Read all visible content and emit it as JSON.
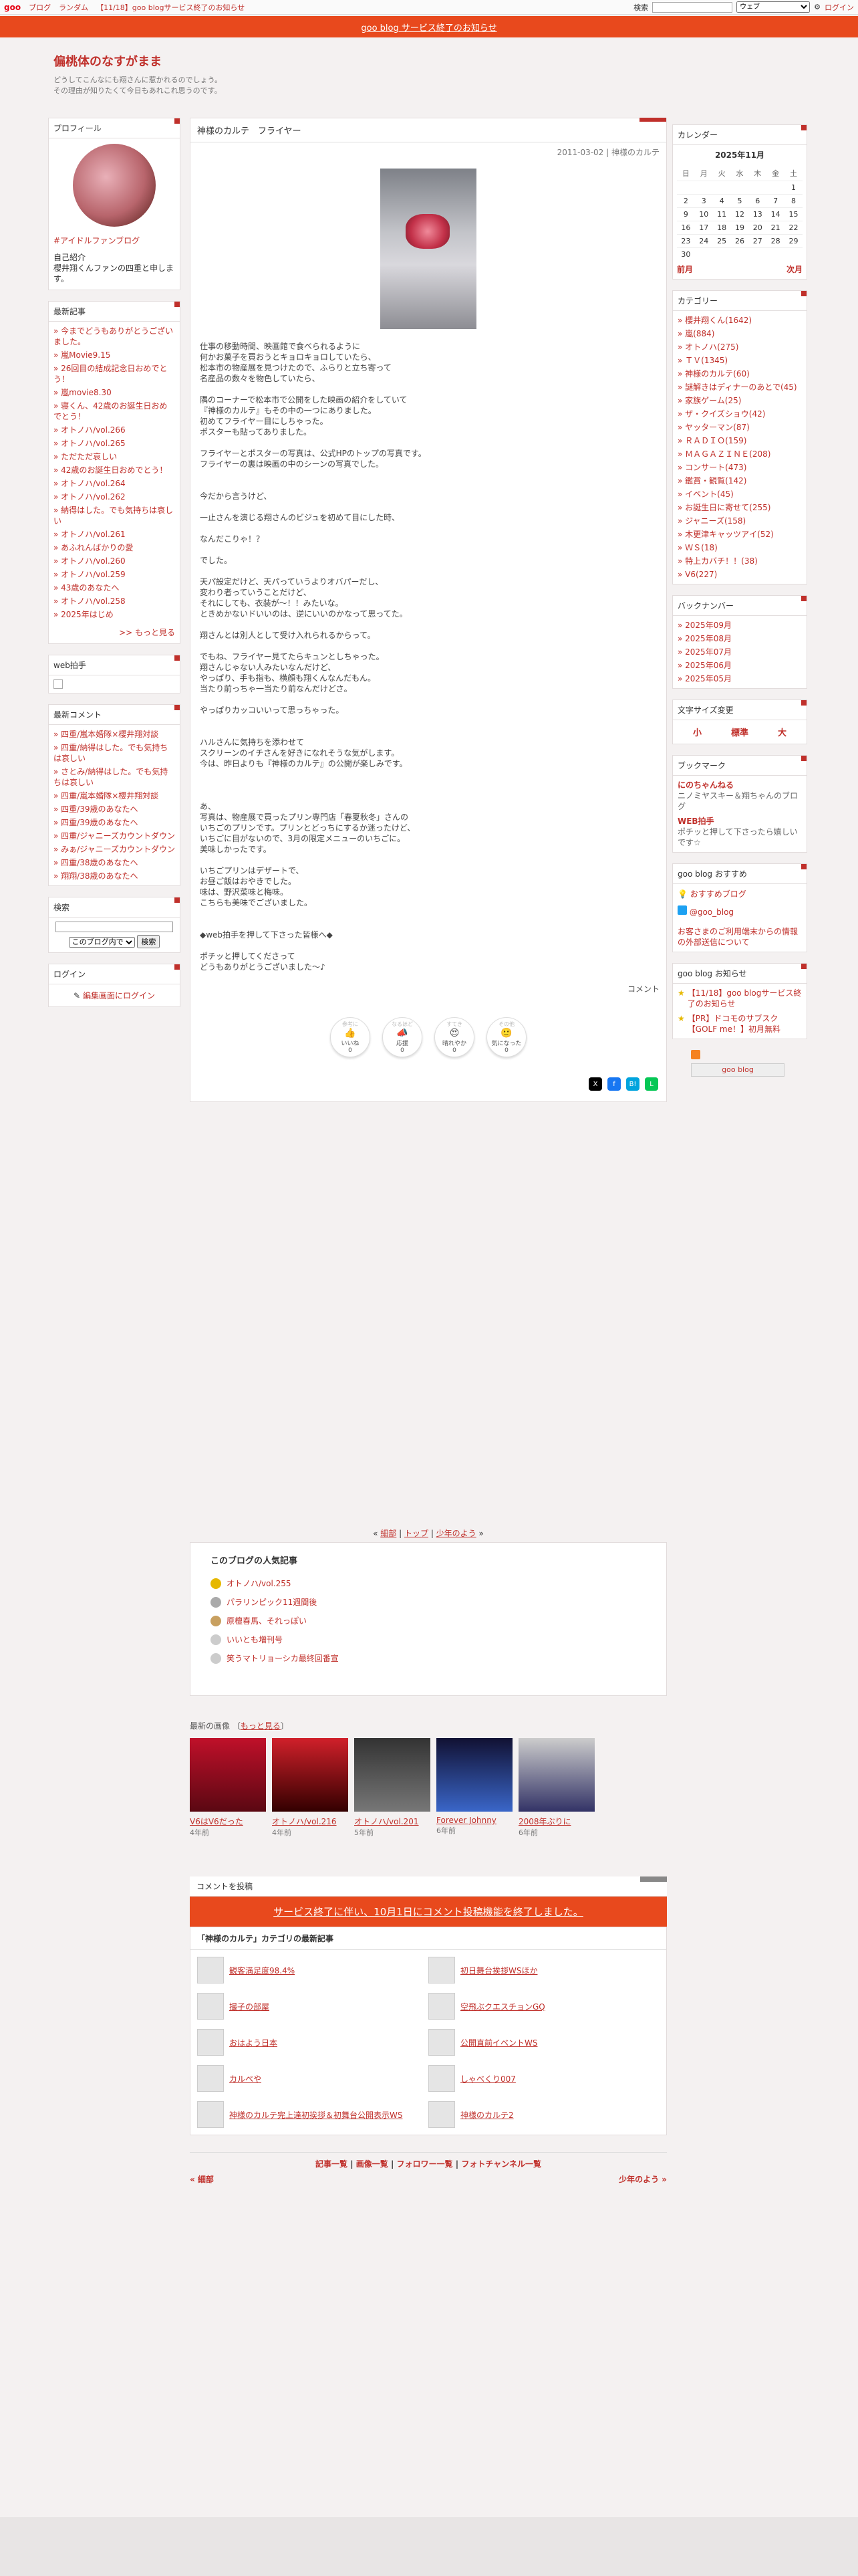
{
  "topbar": {
    "logo": "goo",
    "links": [
      "ブログ",
      "ランダム",
      "【11/18】goo blogサービス終了のお知らせ"
    ],
    "search_label": "検索",
    "select": "ウェブ",
    "login": "ログイン"
  },
  "notice": "goo blog サービス終了のお知らせ",
  "header": {
    "title": "偏桃体のなすがまま",
    "desc1": "どうしてこんなにも翔さんに惹かれるのでしょう。",
    "desc2": "その理由が知りたくて今日もあれこれ思うのです。"
  },
  "profile": {
    "title": "プロフィール",
    "link": "#アイドルファンブログ",
    "intro_title": "自己紹介",
    "intro": "櫻井翔くんファンの四重と申します。"
  },
  "recent_entries": {
    "title": "最新記事",
    "items": [
      "今までどうもありがとうございました。",
      "嵐Movie9.15",
      "26回目の結成記念日おめでとう！",
      "嵐movie8.30",
      "寝くん、42歳のお誕生日おめでとう！",
      "オトノハ/vol.266",
      "オトノハ/vol.265",
      "ただただ哀しい",
      "42歳のお誕生日おめでとう！",
      "オトノハ/vol.264",
      "オトノハ/vol.262",
      "納得はした。でも気持ちは哀しい",
      "オトノハ/vol.261",
      "あふれんばかりの愛",
      "オトノハ/vol.260",
      "オトノハ/vol.259",
      "43歳のあなたへ",
      "オトノハ/vol.258",
      "2025年はじめ"
    ],
    "more": ">> もっと見る"
  },
  "webclap": {
    "title": "web拍手"
  },
  "recent_comments": {
    "title": "最新コメント",
    "items": [
      "四重/嵐本婚隊×櫻井翔対談",
      "四重/納得はした。でも気持ちは哀しい",
      "さとみ/納得はした。でも気持ちは哀しい",
      "四重/嵐本婚隊×櫻井翔対談",
      "四重/39歳のあなたへ",
      "四重/39歳のあなたへ",
      "四重/ジャニーズカウントダウン",
      "みぁ/ジャニーズカウントダウン",
      "四重/38歳のあなたへ",
      "翔翔/38歳のあなたへ"
    ]
  },
  "search": {
    "title": "検索",
    "select": "このブログ内で",
    "button": "検索"
  },
  "login": {
    "title": "ログイン",
    "link": "編集画面にログイン"
  },
  "entry": {
    "title": "神様のカルテ　フライヤー",
    "meta": "2011-03-02 | 神様のカルテ",
    "paragraphs": [
      "仕事の移動時間、映画館で食べられるように",
      "何かお菓子を買おうとキョロキョロしていたら、",
      "松本市の物産展を見つけたので、ふらりと立ち寄って",
      "名産品の数々を物色していたら、",
      "",
      "隅のコーナーで松本市で公開をした映画の紹介をしていて",
      "『神様のカルテ』もその中の一つにありました。",
      "初めてフライヤー目にしちゃった。",
      "ポスターも貼ってありました。",
      "",
      "フライヤーとポスターの写真は、公式HPのトップの写真です。",
      "フライヤーの裏は映画の中のシーンの写真でした。",
      "",
      "",
      "今だから言うけど、",
      "",
      "一止さんを演じる翔さんのビジュを初めて目にした時、",
      "",
      "なんだこりゃ！？",
      "",
      "でした。",
      "",
      "天パ設定だけど、天パっていうよりオバパーだし、",
      "変わり者っていうことだけど、",
      "それにしても、衣装が～！！みたいな。",
      "ときめかないドいいのは、逆にいいのかなって思ってた。",
      "",
      "翔さんとは別人として受け入れられるからって。",
      "",
      "でもね、フライヤー見てたらキュンとしちゃった。",
      "翔さんじゃない人みたいなんだけど、",
      "やっぱり、手も指も、横顔も翔くんなんだもん。",
      "当たり前っちゃ一当たり前なんだけどさ。",
      "",
      "やっぱりカッコいいって思っちゃった。",
      "",
      "",
      "ハルさんに気持ちを添わせて",
      "スクリーンのイチさんを好きになれそうな気がします。",
      "今は、昨日よりも『神様のカルテ』の公開が楽しみです。",
      "",
      "",
      "",
      "あ、",
      "写真は、物産展で買ったプリン専門店「春夏秋冬」さんの",
      "いちごのプリンです。プリンとどっちにするか迷ったけど、",
      "いちごに目がないので、3月の限定メニューのいちごに。",
      "美味しかったです。",
      "",
      "いちごプリンはデザートで、",
      "お昼ご飯はおやきでした。",
      "味は、野沢菜味と梅味。",
      "こちらも美味でございました。",
      "",
      "",
      "◆web拍手を押して下さった皆様へ◆",
      "",
      "ポチッと押してくださって",
      "どうもありがとうございました～♪"
    ],
    "comment_link": "コメント"
  },
  "reactions": [
    {
      "top": "参考に",
      "label": "いいね",
      "count": "0"
    },
    {
      "top": "なるほど",
      "label": "応援",
      "count": "0"
    },
    {
      "top": "すてき",
      "label": "晴れやか",
      "count": "0"
    },
    {
      "top": "その他",
      "label": "気になった",
      "count": "0"
    }
  ],
  "navline": {
    "prev": "細部",
    "top": "トップ",
    "next": "少年のよう"
  },
  "popular": {
    "title": "このブログの人気記事",
    "items": [
      "オトノハ/vol.255",
      "パラリンピック11週間後",
      "原檀春馬、それっぽい",
      "いいとも増刊号",
      "笑うマトリョーシカ最終回番宣"
    ]
  },
  "recent_images": {
    "label": "最新の画像",
    "more": "もっと見る",
    "items": [
      {
        "title": "V6はV6だった",
        "date": "4年前"
      },
      {
        "title": "オトノハ/vol.216",
        "date": "4年前"
      },
      {
        "title": "オトノハ/vol.201",
        "date": "5年前"
      },
      {
        "title": "Forever Johnny",
        "date": "6年前"
      },
      {
        "title": "2008年ぶりに",
        "date": "6年前"
      }
    ]
  },
  "comment": {
    "head": "コメントを投稿",
    "closed": "サービス終了に伴い、10月1日にコメント投稿機能を終了しました。"
  },
  "category_latest": {
    "title": "「神様のカルテ」カテゴリの最新記事",
    "items": [
      "観客満足度98.4%",
      "初日舞台挨拶WSほか",
      "撮子の部屋",
      "空飛ぶクエスチョンGQ",
      "おはよう日本",
      "公開直前イベントWS",
      "カルペや",
      "しゃべくり007",
      "神様のカルテ完上達初挨拶＆初舞台公開表示WS",
      "神様のカルテ2"
    ]
  },
  "footnav": [
    "記事一覧",
    "画像一覧",
    "フォロワー一覧",
    "フォトチャンネル一覧"
  ],
  "prevnext": {
    "prev": "« 細部",
    "next": "少年のよう »"
  },
  "calendar": {
    "title": "カレンダー",
    "month": "2025年11月",
    "days": [
      "日",
      "月",
      "火",
      "水",
      "木",
      "金",
      "土"
    ],
    "rows": [
      [
        "",
        "",
        "",
        "",
        "",
        "",
        "1"
      ],
      [
        "2",
        "3",
        "4",
        "5",
        "6",
        "7",
        "8"
      ],
      [
        "9",
        "10",
        "11",
        "12",
        "13",
        "14",
        "15"
      ],
      [
        "16",
        "17",
        "18",
        "19",
        "20",
        "21",
        "22"
      ],
      [
        "23",
        "24",
        "25",
        "26",
        "27",
        "28",
        "29"
      ],
      [
        "30",
        "",
        "",
        "",
        "",
        "",
        ""
      ]
    ],
    "prev": "前月",
    "next": "次月"
  },
  "categories": {
    "title": "カテゴリー",
    "items": [
      "櫻井翔くん(1642)",
      "嵐(884)",
      "オトノハ(275)",
      "ＴＶ(1345)",
      "神様のカルテ(60)",
      "謎解きはディナーのあとで(45)",
      "家族ゲーム(25)",
      "ザ・クイズショウ(42)",
      "ヤッターマン(87)",
      "ＲＡＤＩＯ(159)",
      "ＭＡＧＡＺＩＮＥ(208)",
      "コンサート(473)",
      "鑑賞・観覧(142)",
      "イベント(45)",
      "お誕生日に寄せて(255)",
      "ジャニーズ(158)",
      "木更津キャッツアイ(52)",
      "ＷＳ(18)",
      "特上カバチ！！(38)",
      "V6(227)"
    ]
  },
  "backnumber": {
    "title": "バックナンバー",
    "items": [
      "2025年09月",
      "2025年08月",
      "2025年07月",
      "2025年06月",
      "2025年05月"
    ]
  },
  "fontsize": {
    "title": "文字サイズ変更",
    "items": [
      "小",
      "標準",
      "大"
    ]
  },
  "bookmark": {
    "title": "ブックマーク",
    "items": [
      {
        "name": "にのちゃんねる",
        "desc": "ニノミヤスキー＆翔ちゃんのブログ"
      },
      {
        "name": "WEB拍手",
        "desc": "ポチッと押して下さったら嬉しいです☆"
      }
    ]
  },
  "goo_recommend": {
    "title": "goo blog おすすめ",
    "items": [
      "おすすめブログ",
      "@goo_blog"
    ],
    "note": "お客さまのご利用端末からの情報の外部送信について"
  },
  "goo_notice": {
    "title": "goo blog お知らせ",
    "items": [
      "【11/18】goo blogサービス終了のお知らせ",
      "【PR】ドコモのサブスク【GOLF me！】初月無料"
    ]
  },
  "goo_badge": "goo blog",
  "colors": {
    "accent": "#c0302b",
    "banner": "#e8491d"
  }
}
